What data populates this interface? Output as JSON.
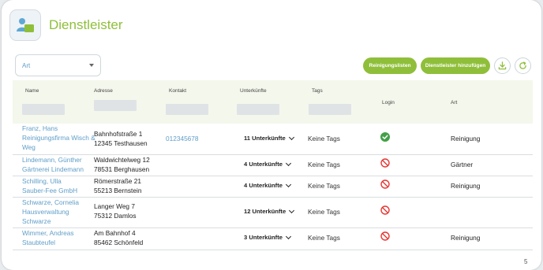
{
  "header": {
    "title": "Dienstleister"
  },
  "filter": {
    "art_placeholder": "Art"
  },
  "buttons": {
    "cleaning_lists": "Reinigungslisten",
    "add_provider": "Dienstleister hinzufügen"
  },
  "columns": [
    "Name",
    "Adresse",
    "Kontakt",
    "Unterkünfte",
    "Tags",
    "Login",
    "Art"
  ],
  "rows": [
    {
      "name": [
        "Franz, Hans",
        "Reinigungsfirma Wisch &",
        "Weg"
      ],
      "address": [
        "Bahnhofstraße 1",
        "12345 Testhausen"
      ],
      "contact": "012345678",
      "units": "11 Unterkünfte",
      "tags": "Keine Tags",
      "login": "check",
      "art": "Reinigung"
    },
    {
      "name": [
        "Lindemann, Günther",
        "Gärtnerei Lindemann"
      ],
      "address": [
        "Waldwichtelweg 12",
        "78531 Berghausen"
      ],
      "contact": "",
      "units": "4 Unterkünfte",
      "tags": "Keine Tags",
      "login": "blocked",
      "art": "Gärtner"
    },
    {
      "name": [
        "Schilling, Ulla",
        "Sauber-Fee GmbH"
      ],
      "address": [
        "Römerstraße 21",
        "55213 Bernstein"
      ],
      "contact": "",
      "units": "4 Unterkünfte",
      "tags": "Keine Tags",
      "login": "blocked",
      "art": "Reinigung"
    },
    {
      "name": [
        "Schwarze, Cornelia",
        "Hausverwaltung",
        "Schwarze"
      ],
      "address": [
        "Langer Weg 7",
        "75312 Damlos"
      ],
      "contact": "",
      "units": "12 Unterkünfte",
      "tags": "Keine Tags",
      "login": "blocked",
      "art": ""
    },
    {
      "name": [
        "Wimmer, Andreas",
        "Staubteufel"
      ],
      "address": [
        "Am Bahnhof 4",
        "85462 Schönfeld"
      ],
      "contact": "",
      "units": "3 Unterkünfte",
      "tags": "Keine Tags",
      "login": "blocked",
      "art": "Reinigung"
    }
  ],
  "pagination": {
    "page": "5"
  },
  "colors": {
    "accent": "#8fbf3a",
    "link": "#5f9ec8",
    "success": "#43a047",
    "blocked": "#e53935"
  }
}
